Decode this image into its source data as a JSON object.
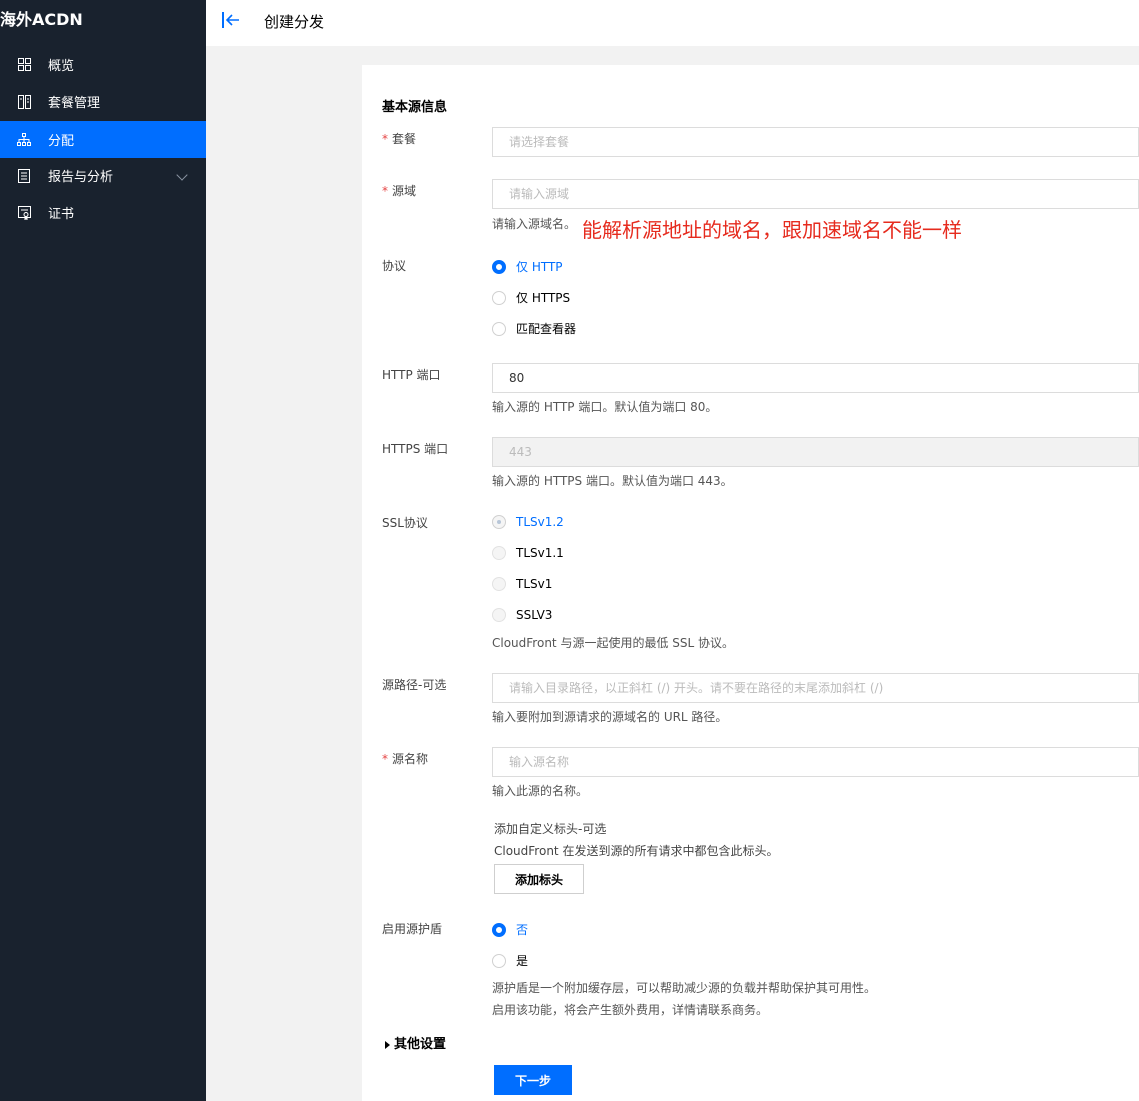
{
  "sidebar": {
    "brand": "海外ACDN",
    "items": [
      {
        "label": "概览",
        "icon": "grid-icon"
      },
      {
        "label": "套餐管理",
        "icon": "book-icon"
      },
      {
        "label": "分配",
        "icon": "tree-icon"
      },
      {
        "label": "报告与分析",
        "icon": "document-icon"
      },
      {
        "label": "证书",
        "icon": "certificate-icon"
      }
    ],
    "active_index": 2
  },
  "header": {
    "title": "创建分发"
  },
  "form": {
    "section_title": "基本源信息",
    "package": {
      "label": "套餐",
      "placeholder": "请选择套餐"
    },
    "origin_domain": {
      "label": "源域",
      "placeholder": "请输入源域",
      "hint": "请输入源域名。",
      "annotation": "能解析源地址的域名，跟加速域名不能一样"
    },
    "protocol": {
      "label": "协议",
      "options": [
        "仅 HTTP",
        "仅 HTTPS",
        "匹配查看器"
      ],
      "selected": "仅 HTTP"
    },
    "http_port": {
      "label": "HTTP 端口",
      "value": "80",
      "hint": "输入源的 HTTP 端口。默认值为端口 80。"
    },
    "https_port": {
      "label": "HTTPS 端口",
      "value": "443",
      "hint": "输入源的 HTTPS 端口。默认值为端口 443。"
    },
    "ssl": {
      "label": "SSL协议",
      "options": [
        "TLSv1.2",
        "TLSv1.1",
        "TLSv1",
        "SSLV3"
      ],
      "selected": "TLSv1.2",
      "hint": "CloudFront 与源一起使用的最低 SSL 协议。"
    },
    "origin_path": {
      "label": "源路径-可选",
      "placeholder": "请输入目录路径，以正斜杠 (/) 开头。请不要在路径的末尾添加斜杠 (/)",
      "hint": "输入要附加到源请求的源域名的 URL 路径。"
    },
    "origin_name": {
      "label": "源名称",
      "placeholder": "输入源名称",
      "hint": "输入此源的名称。"
    },
    "custom_header": {
      "title": "添加自定义标头-可选",
      "desc": "CloudFront 在发送到源的所有请求中都包含此标头。",
      "button": "添加标头"
    },
    "origin_shield": {
      "label": "启用源护盾",
      "options": [
        "否",
        "是"
      ],
      "selected": "否",
      "hint1": "源护盾是一个附加缓存层，可以帮助减少源的负载并帮助保护其可用性。",
      "hint2": "启用该功能，将会产生额外费用，详情请联系商务。"
    },
    "other_settings": "其他设置",
    "next_button": "下一步"
  }
}
